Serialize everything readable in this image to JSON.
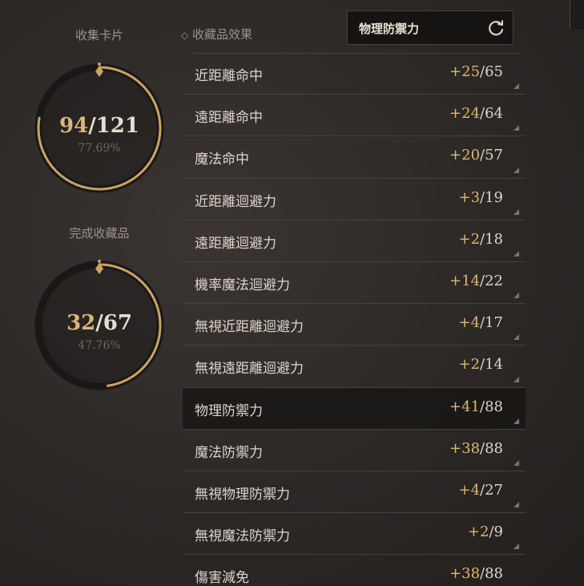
{
  "left": {
    "cards_title": "收集卡片",
    "cards_current": "94",
    "cards_total": "/121",
    "cards_pct": "77.69%",
    "cards_progress": 0.7769,
    "complete_title": "完成收藏品",
    "complete_current": "32",
    "complete_total": "/67",
    "complete_pct": "47.76%",
    "complete_progress": 0.4776
  },
  "effects": {
    "header": "收藏品效果",
    "filter_label": "物理防禦力",
    "rows": [
      {
        "name": "近距離命中",
        "bonus": "+25",
        "max": "/65",
        "selected": false
      },
      {
        "name": "遠距離命中",
        "bonus": "+24",
        "max": "/64",
        "selected": false
      },
      {
        "name": "魔法命中",
        "bonus": "+20",
        "max": "/57",
        "selected": false
      },
      {
        "name": "近距離迴避力",
        "bonus": "+3",
        "max": "/19",
        "selected": false
      },
      {
        "name": "遠距離迴避力",
        "bonus": "+2",
        "max": "/18",
        "selected": false
      },
      {
        "name": "機率魔法迴避力",
        "bonus": "+14",
        "max": "/22",
        "selected": false
      },
      {
        "name": "無視近距離迴避力",
        "bonus": "+4",
        "max": "/17",
        "selected": false
      },
      {
        "name": "無視遠距離迴避力",
        "bonus": "+2",
        "max": "/14",
        "selected": false
      },
      {
        "name": "物理防禦力",
        "bonus": "+41",
        "max": "/88",
        "selected": true
      },
      {
        "name": "魔法防禦力",
        "bonus": "+38",
        "max": "/88",
        "selected": false
      },
      {
        "name": "無視物理防禦力",
        "bonus": "+4",
        "max": "/27",
        "selected": false
      },
      {
        "name": "無視魔法防禦力",
        "bonus": "+2",
        "max": "/9",
        "selected": false
      },
      {
        "name": "傷害減免",
        "bonus": "+38",
        "max": "/88",
        "selected": false
      }
    ]
  },
  "colors": {
    "gold": "#dfb86f",
    "ring_gold": "#c9a465"
  }
}
